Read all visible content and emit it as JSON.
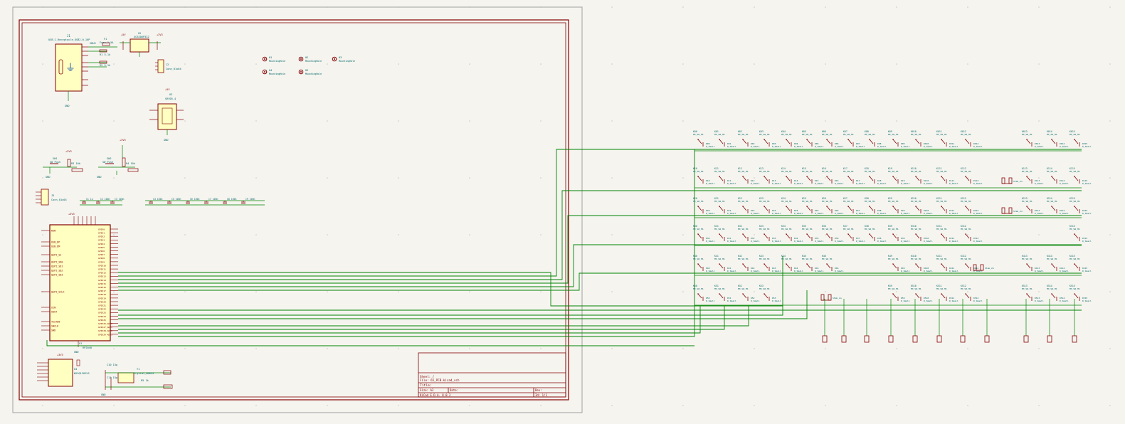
{
  "colors": {
    "background": "#f5f4ef",
    "frame": "#840000",
    "body_fill": "#ffffc2",
    "wire": "#008400",
    "label": "#006666",
    "sheet_border": "#a0a0a0"
  },
  "sheet": {
    "usb": {
      "ref": "J1",
      "value": "USB_C_Receptacle_USB2.0_16P",
      "net_vbus": "VBUS",
      "fuse_ref": "F1",
      "fuse_value": "Fuse_1.5A",
      "r1": "R1 5.1k",
      "r2": "R2 5.1k",
      "gnd": "GND"
    },
    "regulator": {
      "ref": "U2",
      "value": "XC6206P332",
      "v_in": "+5V",
      "v_out": "+3V3"
    },
    "conn": {
      "ref": "J2",
      "value": "Conn_01x04"
    },
    "esd": {
      "ref": "U3",
      "value": "SRV05-4",
      "v": "+5V",
      "gnd": "GND"
    },
    "holes": [
      {
        "ref": "H1",
        "value": "MountingHole"
      },
      {
        "ref": "H2",
        "value": "MountingHole"
      },
      {
        "ref": "H3",
        "value": "MountingHole"
      },
      {
        "ref": "H4",
        "value": "MountingHole"
      },
      {
        "ref": "H5",
        "value": "MountingHole"
      }
    ],
    "reset": {
      "ref": "SW1",
      "value": "SW_Push",
      "r": "R3 10k",
      "gnd": "GND",
      "v": "+3V3"
    },
    "boot": {
      "ref": "SW2",
      "value": "SW_Push",
      "r": "R4 10k",
      "gnd": "GND",
      "v": "+3V3"
    },
    "debug": {
      "ref": "J3",
      "value": "Conn_01x04"
    },
    "decoupling_a": [
      "C1 1u",
      "C2 100n",
      "C3 100n"
    ],
    "decoupling_b": [
      "C4 100n",
      "C5 100n",
      "C6 100n",
      "C7 100n",
      "C8 100n",
      "C9 100n"
    ],
    "mcu": {
      "ref": "U1",
      "value": "RP2040",
      "v": "+3V3",
      "left_pins": [
        "RUN",
        "USB_DP",
        "USB_DM",
        "QSPI_SS",
        "QSPI_SD0",
        "QSPI_SD1",
        "QSPI_SD2",
        "QSPI_SD3",
        "QSPI_SCLK",
        "XIN",
        "XOUT",
        "TESTEN",
        "SWCLK",
        "SWD"
      ],
      "right_pins": [
        "GPIO0",
        "GPIO1",
        "GPIO2",
        "GPIO3",
        "GPIO4",
        "GPIO5",
        "GPIO6",
        "GPIO7",
        "GPIO8",
        "GPIO9",
        "GPIO10",
        "GPIO11",
        "GPIO12",
        "GPIO13",
        "GPIO14",
        "GPIO15",
        "GPIO16",
        "GPIO17",
        "GPIO18",
        "GPIO19",
        "GPIO20",
        "GPIO21",
        "GPIO22",
        "GPIO23",
        "GPIO24",
        "GPIO25",
        "GPIO26_ADC0",
        "GPIO27_ADC1",
        "GPIO28_ADC2",
        "GPIO29_ADC3"
      ],
      "gnd": "GND"
    },
    "flash": {
      "ref": "U4",
      "value": "W25Q128JVS",
      "v": "+3V3"
    },
    "crystal": {
      "ref": "Y1",
      "value": "Crystal_GND24",
      "c1": "C10 15p",
      "c2": "C11 15p",
      "r": "R5 1k",
      "gnd": "GND"
    }
  },
  "title_block": {
    "sheet_line": "Sheet: /",
    "file_line": "File: 65_PCB.kicad_sch",
    "title_line": "Title:",
    "size_line": "Size: A3",
    "date_line": "Date:",
    "kicad_line": "KiCad E.D.A. 8.0.2",
    "rev_line": "Rev:",
    "id_line": "Id: 1/1"
  },
  "matrix": {
    "columns": [
      "COL0",
      "COL1",
      "COL2",
      "COL3",
      "COL4",
      "COL5",
      "COL6",
      "COL7",
      "COL8",
      "COL9",
      "COL10",
      "COL11",
      "COL12",
      "COL13",
      "COL14",
      "COL15",
      "COL16"
    ],
    "rows": [
      "ROW0",
      "ROW1",
      "ROW2",
      "ROW3",
      "ROW4",
      "ROW5"
    ],
    "switch_value": "MX_SW_HS",
    "diode_value": "D_Small",
    "stab_label": "Stab_2u"
  }
}
